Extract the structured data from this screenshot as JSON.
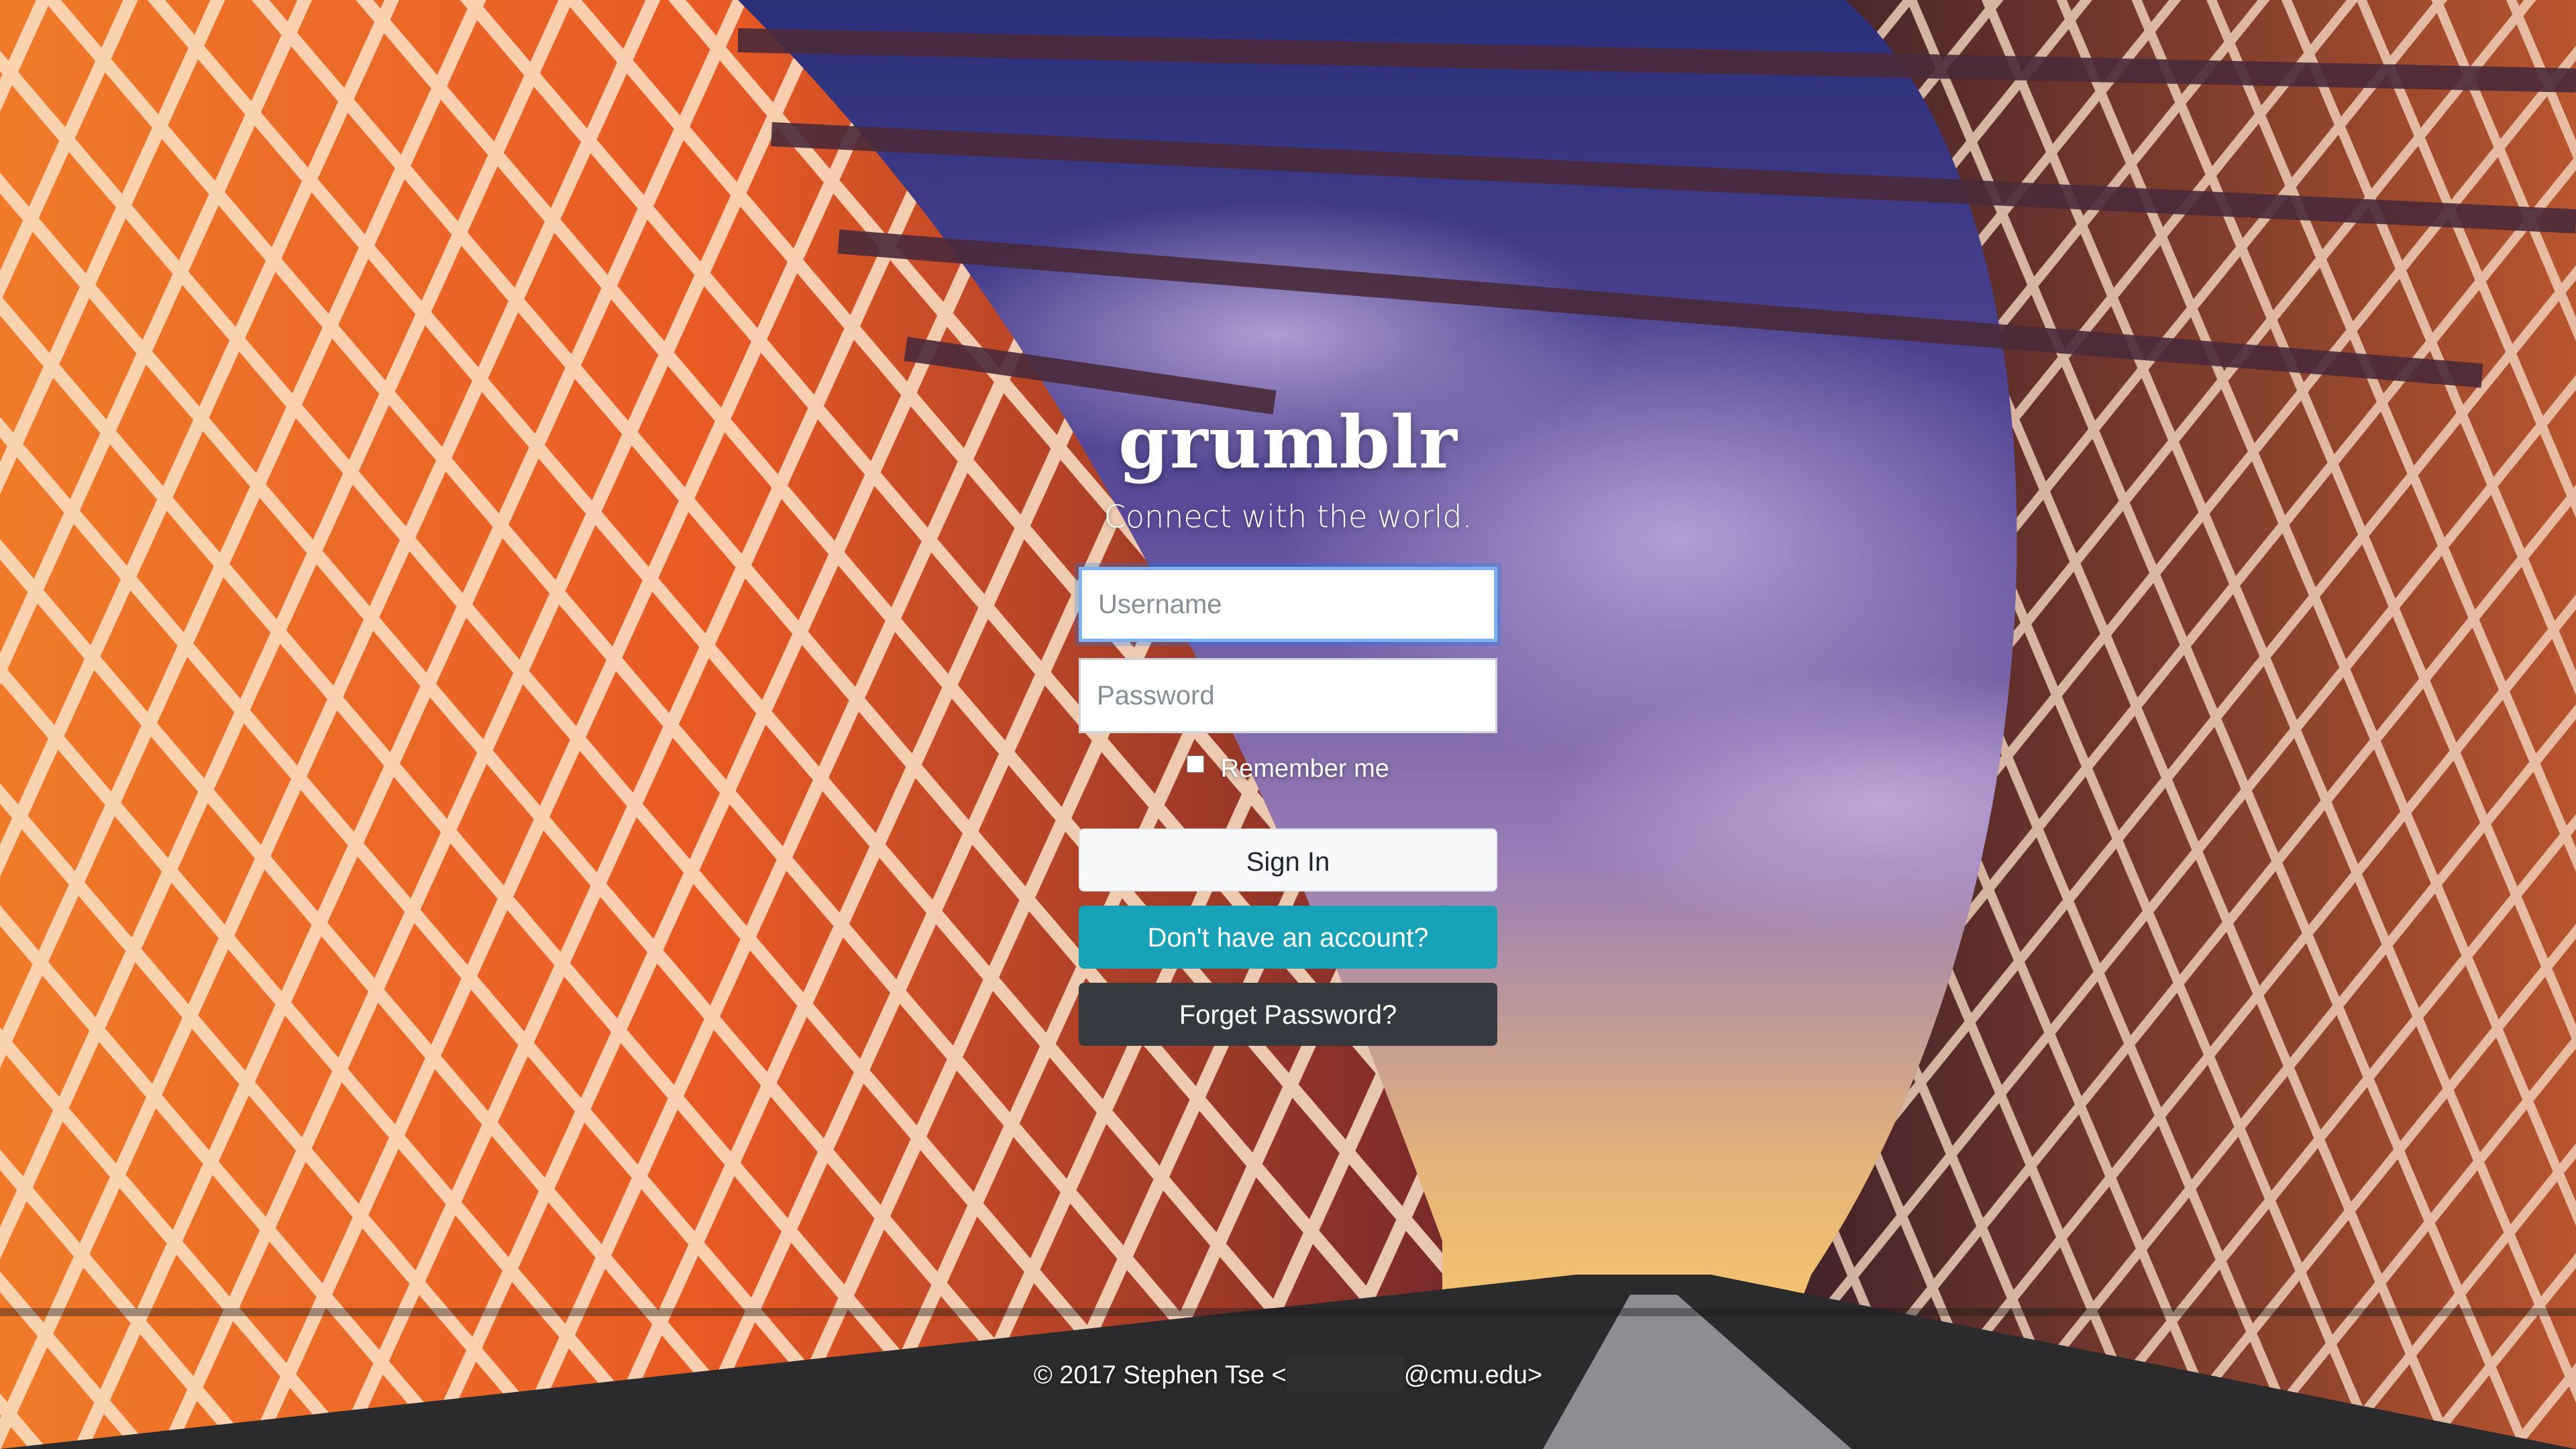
{
  "brand": {
    "title": "grumblr",
    "tagline": "Connect with the world."
  },
  "login_form": {
    "username_placeholder": "Username",
    "password_placeholder": "Password",
    "remember_label": "Remember me",
    "remember_checked": false,
    "signin_label": "Sign In",
    "signup_label": "Don't have an account?",
    "forgot_label": "Forget Password?"
  },
  "footer": {
    "prefix": "© 2017 Stephen Tse <",
    "suffix": "@cmu.edu>"
  },
  "colors": {
    "signup_button": "#17a2b8",
    "forgot_button": "#343a40",
    "signin_button": "#f8f9fa",
    "focus_ring": "#7fb2f0"
  },
  "background": {
    "description_icon": "bridge-photo-background"
  }
}
